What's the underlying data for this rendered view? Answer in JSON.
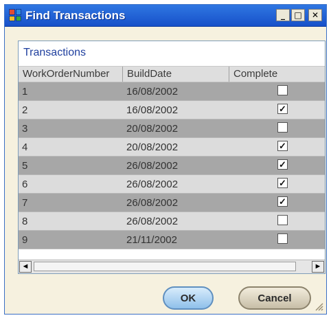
{
  "window": {
    "title": "Find Transactions"
  },
  "controls": {
    "minimize": "_",
    "maximize": "□",
    "close": "✕"
  },
  "grid": {
    "caption": "Transactions",
    "columns": [
      "WorkOrderNumber",
      "BuildDate",
      "Complete"
    ],
    "rows": [
      {
        "id": "1",
        "date": "16/08/2002",
        "complete": false
      },
      {
        "id": "2",
        "date": "16/08/2002",
        "complete": true
      },
      {
        "id": "3",
        "date": "20/08/2002",
        "complete": false
      },
      {
        "id": "4",
        "date": "20/08/2002",
        "complete": true
      },
      {
        "id": "5",
        "date": "26/08/2002",
        "complete": true
      },
      {
        "id": "6",
        "date": "26/08/2002",
        "complete": true
      },
      {
        "id": "7",
        "date": "26/08/2002",
        "complete": true
      },
      {
        "id": "8",
        "date": "26/08/2002",
        "complete": false
      },
      {
        "id": "9",
        "date": "21/11/2002",
        "complete": false
      }
    ]
  },
  "scroll": {
    "left": "◄",
    "right": "►"
  },
  "buttons": {
    "ok": "OK",
    "cancel": "Cancel"
  },
  "colors": {
    "titlebar": "#1f62db",
    "accent": "#1f3f9e",
    "dialog_bg": "#f6f1df"
  },
  "icons": [
    "app-icon",
    "minimize-icon",
    "maximize-icon",
    "close-icon",
    "scroll-left-icon",
    "scroll-right-icon",
    "resize-grip-icon"
  ]
}
